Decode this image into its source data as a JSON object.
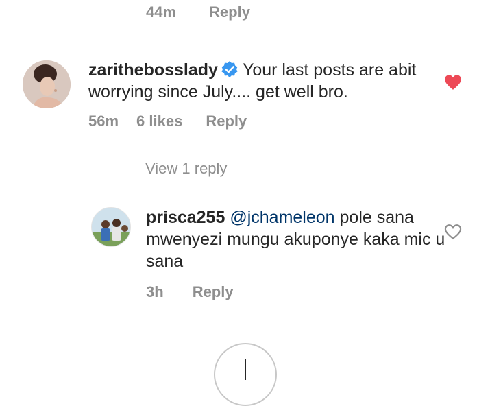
{
  "previous_comment": {
    "time": "44m",
    "reply_label": "Reply"
  },
  "comments": [
    {
      "username": "zarithebosslady",
      "verified": true,
      "text": "Your last posts are abit worrying since July.... get well bro.",
      "time": "56m",
      "likes": "6 likes",
      "reply_label": "Reply",
      "liked": true,
      "heart_color": "#ed4956"
    }
  ],
  "view_replies": {
    "label": "View 1 reply"
  },
  "replies": [
    {
      "username": "prisca255",
      "mention": "@jchameleon",
      "text": "pole sana mwenyezi mungu akuponye kaka mic u sana",
      "time": "3h",
      "reply_label": "Reply",
      "liked": false
    }
  ],
  "colors": {
    "secondary_text": "#8e8e8e",
    "mention": "#003569",
    "verified_badge": "#3897f0"
  }
}
